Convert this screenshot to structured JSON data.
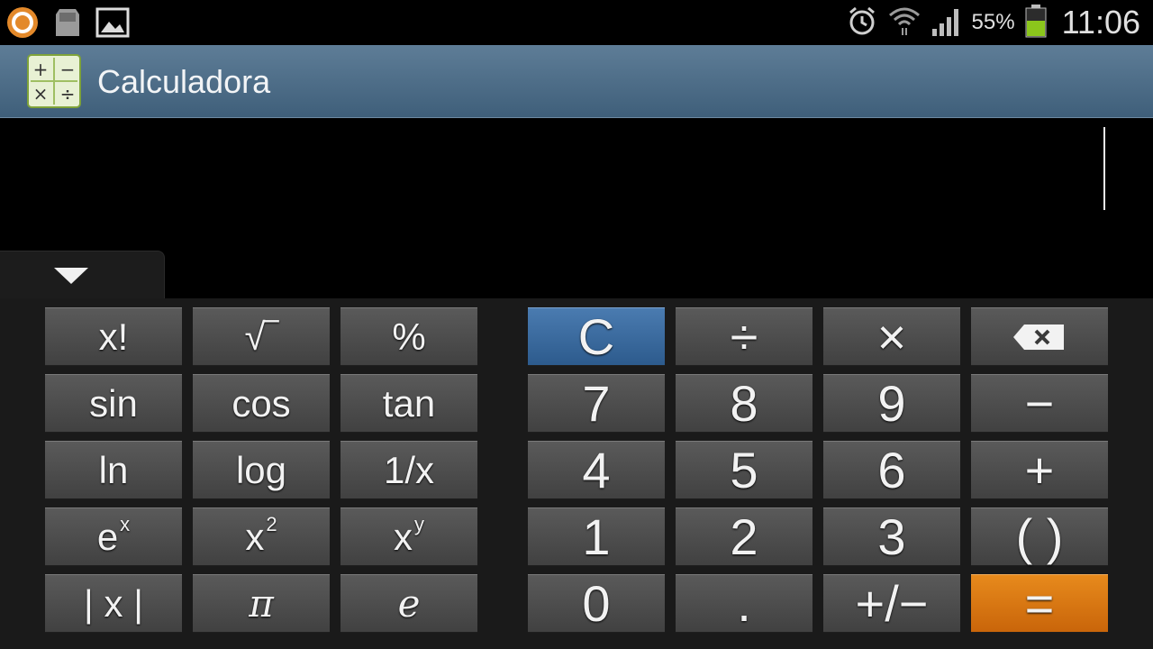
{
  "status_bar": {
    "notification_icons": [
      "avast-icon",
      "sd-card-icon",
      "picture-icon"
    ],
    "right_icons": [
      "alarm-clock-icon",
      "wifi-icon",
      "signal-icon"
    ],
    "battery_percent": "55%",
    "battery_level": 0.55,
    "time": "11:06"
  },
  "action_bar": {
    "title": "Calculadora",
    "icon": "calculator-icon",
    "icon_glyphs": [
      "+",
      "−",
      "×",
      "÷"
    ]
  },
  "display": {
    "expression": "",
    "history_toggle_icon": "chevron-down-icon"
  },
  "colors": {
    "action_bar": "#4f6f8a",
    "clear_key": "#3a6b9f",
    "equals_key": "#d9770f",
    "key": "#4d4d4d"
  },
  "keys": {
    "factorial": "x!",
    "sqrt": "√‾",
    "percent": "%",
    "sin": "sin",
    "cos": "cos",
    "tan": "tan",
    "ln": "ln",
    "log": "log",
    "reciprocal": "1/x",
    "exp_base": "e",
    "exp_sup": "x",
    "square_base": "x",
    "square_sup": "2",
    "power_base": "x",
    "power_sup": "y",
    "abs": "| x |",
    "pi": "π",
    "e": "e",
    "clear": "C",
    "divide": "÷",
    "multiply": "×",
    "backspace_icon": "backspace-icon",
    "seven": "7",
    "eight": "8",
    "nine": "9",
    "minus": "−",
    "four": "4",
    "five": "5",
    "six": "6",
    "plus": "+",
    "one": "1",
    "two": "2",
    "three": "3",
    "parentheses": "( )",
    "zero": "0",
    "decimal": ".",
    "plus_minus": "+/−",
    "equals": "="
  }
}
